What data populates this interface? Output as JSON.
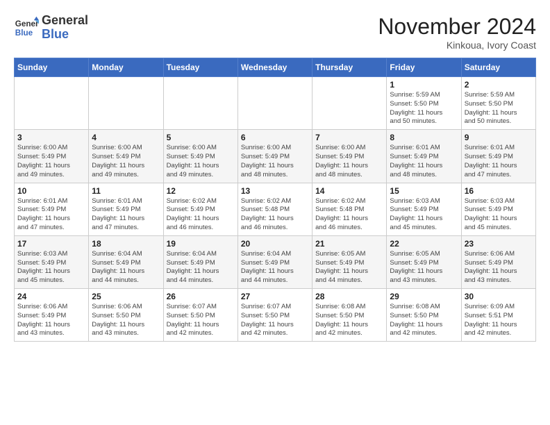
{
  "header": {
    "logo_line1": "General",
    "logo_line2": "Blue",
    "month_title": "November 2024",
    "location": "Kinkoua, Ivory Coast"
  },
  "weekdays": [
    "Sunday",
    "Monday",
    "Tuesday",
    "Wednesday",
    "Thursday",
    "Friday",
    "Saturday"
  ],
  "weeks": [
    [
      {
        "day": "",
        "info": ""
      },
      {
        "day": "",
        "info": ""
      },
      {
        "day": "",
        "info": ""
      },
      {
        "day": "",
        "info": ""
      },
      {
        "day": "",
        "info": ""
      },
      {
        "day": "1",
        "info": "Sunrise: 5:59 AM\nSunset: 5:50 PM\nDaylight: 11 hours\nand 50 minutes."
      },
      {
        "day": "2",
        "info": "Sunrise: 5:59 AM\nSunset: 5:50 PM\nDaylight: 11 hours\nand 50 minutes."
      }
    ],
    [
      {
        "day": "3",
        "info": "Sunrise: 6:00 AM\nSunset: 5:49 PM\nDaylight: 11 hours\nand 49 minutes."
      },
      {
        "day": "4",
        "info": "Sunrise: 6:00 AM\nSunset: 5:49 PM\nDaylight: 11 hours\nand 49 minutes."
      },
      {
        "day": "5",
        "info": "Sunrise: 6:00 AM\nSunset: 5:49 PM\nDaylight: 11 hours\nand 49 minutes."
      },
      {
        "day": "6",
        "info": "Sunrise: 6:00 AM\nSunset: 5:49 PM\nDaylight: 11 hours\nand 48 minutes."
      },
      {
        "day": "7",
        "info": "Sunrise: 6:00 AM\nSunset: 5:49 PM\nDaylight: 11 hours\nand 48 minutes."
      },
      {
        "day": "8",
        "info": "Sunrise: 6:01 AM\nSunset: 5:49 PM\nDaylight: 11 hours\nand 48 minutes."
      },
      {
        "day": "9",
        "info": "Sunrise: 6:01 AM\nSunset: 5:49 PM\nDaylight: 11 hours\nand 47 minutes."
      }
    ],
    [
      {
        "day": "10",
        "info": "Sunrise: 6:01 AM\nSunset: 5:49 PM\nDaylight: 11 hours\nand 47 minutes."
      },
      {
        "day": "11",
        "info": "Sunrise: 6:01 AM\nSunset: 5:49 PM\nDaylight: 11 hours\nand 47 minutes."
      },
      {
        "day": "12",
        "info": "Sunrise: 6:02 AM\nSunset: 5:49 PM\nDaylight: 11 hours\nand 46 minutes."
      },
      {
        "day": "13",
        "info": "Sunrise: 6:02 AM\nSunset: 5:48 PM\nDaylight: 11 hours\nand 46 minutes."
      },
      {
        "day": "14",
        "info": "Sunrise: 6:02 AM\nSunset: 5:48 PM\nDaylight: 11 hours\nand 46 minutes."
      },
      {
        "day": "15",
        "info": "Sunrise: 6:03 AM\nSunset: 5:49 PM\nDaylight: 11 hours\nand 45 minutes."
      },
      {
        "day": "16",
        "info": "Sunrise: 6:03 AM\nSunset: 5:49 PM\nDaylight: 11 hours\nand 45 minutes."
      }
    ],
    [
      {
        "day": "17",
        "info": "Sunrise: 6:03 AM\nSunset: 5:49 PM\nDaylight: 11 hours\nand 45 minutes."
      },
      {
        "day": "18",
        "info": "Sunrise: 6:04 AM\nSunset: 5:49 PM\nDaylight: 11 hours\nand 44 minutes."
      },
      {
        "day": "19",
        "info": "Sunrise: 6:04 AM\nSunset: 5:49 PM\nDaylight: 11 hours\nand 44 minutes."
      },
      {
        "day": "20",
        "info": "Sunrise: 6:04 AM\nSunset: 5:49 PM\nDaylight: 11 hours\nand 44 minutes."
      },
      {
        "day": "21",
        "info": "Sunrise: 6:05 AM\nSunset: 5:49 PM\nDaylight: 11 hours\nand 44 minutes."
      },
      {
        "day": "22",
        "info": "Sunrise: 6:05 AM\nSunset: 5:49 PM\nDaylight: 11 hours\nand 43 minutes."
      },
      {
        "day": "23",
        "info": "Sunrise: 6:06 AM\nSunset: 5:49 PM\nDaylight: 11 hours\nand 43 minutes."
      }
    ],
    [
      {
        "day": "24",
        "info": "Sunrise: 6:06 AM\nSunset: 5:49 PM\nDaylight: 11 hours\nand 43 minutes."
      },
      {
        "day": "25",
        "info": "Sunrise: 6:06 AM\nSunset: 5:50 PM\nDaylight: 11 hours\nand 43 minutes."
      },
      {
        "day": "26",
        "info": "Sunrise: 6:07 AM\nSunset: 5:50 PM\nDaylight: 11 hours\nand 42 minutes."
      },
      {
        "day": "27",
        "info": "Sunrise: 6:07 AM\nSunset: 5:50 PM\nDaylight: 11 hours\nand 42 minutes."
      },
      {
        "day": "28",
        "info": "Sunrise: 6:08 AM\nSunset: 5:50 PM\nDaylight: 11 hours\nand 42 minutes."
      },
      {
        "day": "29",
        "info": "Sunrise: 6:08 AM\nSunset: 5:50 PM\nDaylight: 11 hours\nand 42 minutes."
      },
      {
        "day": "30",
        "info": "Sunrise: 6:09 AM\nSunset: 5:51 PM\nDaylight: 11 hours\nand 42 minutes."
      }
    ]
  ]
}
